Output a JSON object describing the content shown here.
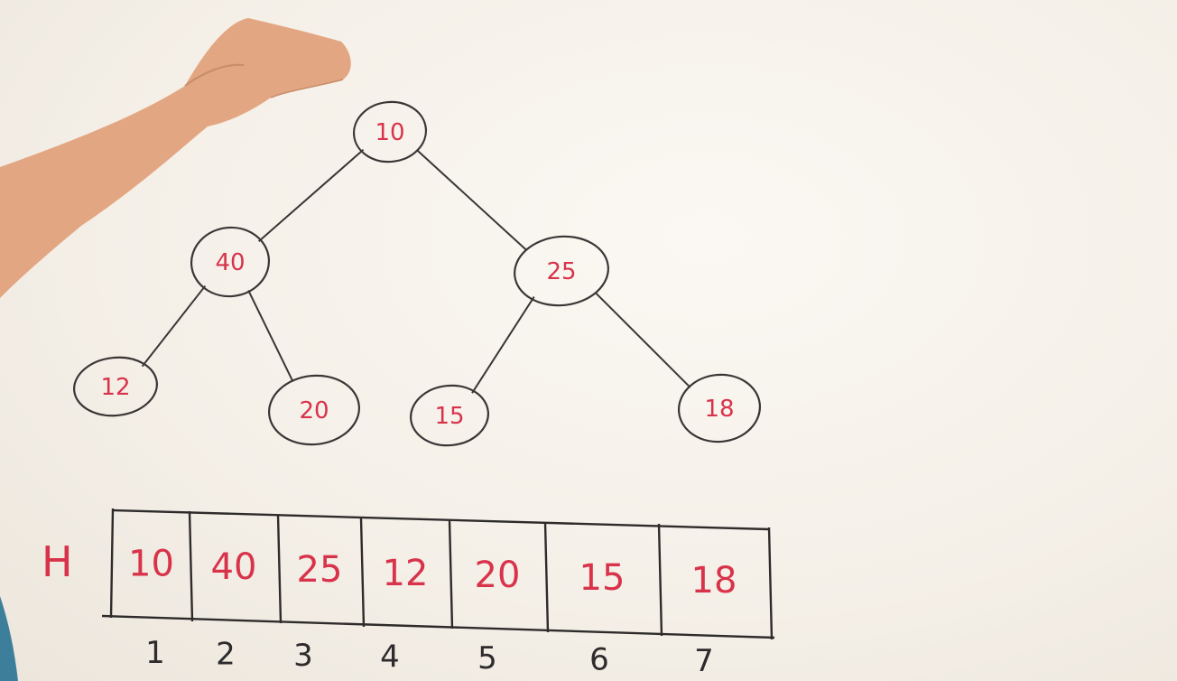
{
  "tree": {
    "nodes": [
      {
        "id": "n1",
        "value": "10"
      },
      {
        "id": "n2",
        "value": "40"
      },
      {
        "id": "n3",
        "value": "25"
      },
      {
        "id": "n4",
        "value": "12"
      },
      {
        "id": "n5",
        "value": "20"
      },
      {
        "id": "n6",
        "value": "15"
      },
      {
        "id": "n7",
        "value": "18"
      }
    ],
    "edges": [
      [
        "n1",
        "n2"
      ],
      [
        "n1",
        "n3"
      ],
      [
        "n2",
        "n4"
      ],
      [
        "n2",
        "n5"
      ],
      [
        "n3",
        "n6"
      ],
      [
        "n3",
        "n7"
      ]
    ]
  },
  "array": {
    "label": "H",
    "cells": [
      "10",
      "40",
      "25",
      "12",
      "20",
      "15",
      "18"
    ],
    "indices": [
      "1",
      "2",
      "3",
      "4",
      "5",
      "6",
      "7"
    ]
  },
  "colors": {
    "ink_red": "#d8334a",
    "ink_dark": "#2d2b2b",
    "skin": "#e3a682"
  }
}
